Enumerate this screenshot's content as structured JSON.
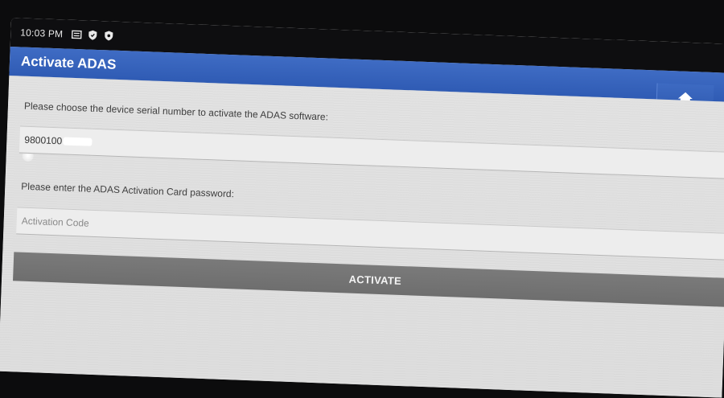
{
  "status_bar": {
    "time": "10:03 PM",
    "icons": [
      "notification-card-icon",
      "shield-icon",
      "shield-icon"
    ]
  },
  "app_bar": {
    "title": "Activate ADAS",
    "home_icon": "home-icon"
  },
  "form": {
    "serial_label": "Please choose the device serial number to activate the ADAS software:",
    "serial_value": "9800100",
    "password_label": "Please enter the ADAS Activation Card password:",
    "activation_code_placeholder": "Activation Code",
    "activation_code_value": "",
    "activate_label": "ACTIVATE"
  },
  "colors": {
    "app_bar": "#3565bb",
    "button": "#757575",
    "background": "#e2e2e2"
  }
}
